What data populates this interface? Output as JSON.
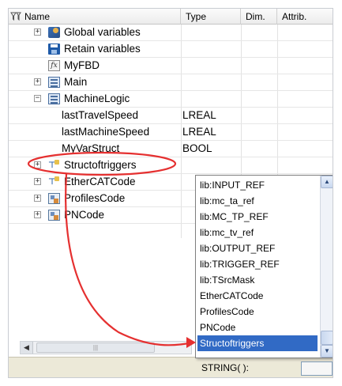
{
  "header": {
    "filter_icon": "filter-icon",
    "columns": [
      "Name",
      "Type",
      "Dim.",
      "Attrib."
    ]
  },
  "tree": [
    {
      "name": "Global variables",
      "icon": "global-variables-icon",
      "expander": "+",
      "type": ""
    },
    {
      "name": "Retain variables",
      "icon": "disk-icon",
      "expander": "",
      "type": ""
    },
    {
      "name": "MyFBD",
      "icon": "function-block-icon",
      "expander": "",
      "type": ""
    },
    {
      "name": "Main",
      "icon": "program-icon",
      "expander": "+",
      "type": ""
    },
    {
      "name": "MachineLogic",
      "icon": "program-icon",
      "expander": "−",
      "type": ""
    },
    {
      "name": "lastTravelSpeed",
      "icon": "",
      "expander": "",
      "type": "LREAL"
    },
    {
      "name": "lastMachineSpeed",
      "icon": "",
      "expander": "",
      "type": "LREAL"
    },
    {
      "name": "MyVarStruct",
      "icon": "",
      "expander": "",
      "type": "BOOL"
    },
    {
      "name": "Structoftriggers",
      "icon": "struct-icon",
      "expander": "+",
      "type": ""
    },
    {
      "name": "EtherCATCode",
      "icon": "struct-icon",
      "expander": "+",
      "type": ""
    },
    {
      "name": "ProfilesCode",
      "icon": "code-icon",
      "expander": "+",
      "type": ""
    },
    {
      "name": "PNCode",
      "icon": "code-icon",
      "expander": "+",
      "type": ""
    }
  ],
  "dropdown": {
    "items": [
      "lib:INPUT_REF",
      "lib:mc_ta_ref",
      "lib:MC_TP_REF",
      "lib:mc_tv_ref",
      "lib:OUTPUT_REF",
      "lib:TRIGGER_REF",
      "lib:TSrcMask",
      "EtherCATCode",
      "ProfilesCode",
      "PNCode",
      "Structoftriggers"
    ],
    "selected": "Structoftriggers"
  },
  "status": {
    "label": "STRING( ):"
  },
  "colors": {
    "selection": "#316ac5",
    "annotation": "#e53030"
  }
}
